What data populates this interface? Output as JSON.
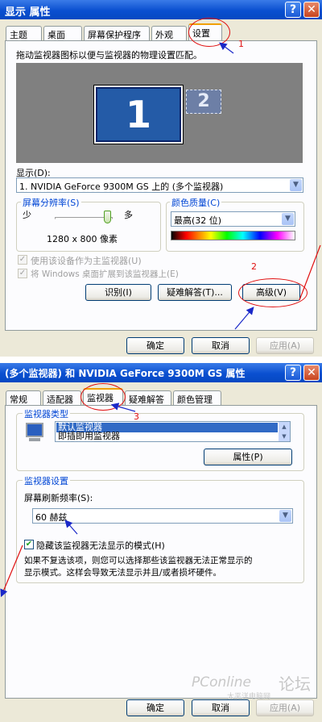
{
  "dialog1": {
    "title": "显示 属性",
    "tabs": [
      "主题",
      "桌面",
      "屏幕保护程序",
      "外观",
      "设置"
    ],
    "description": "拖动监视器图标以便与监视器的物理设置匹配。",
    "monitor1_number": "1",
    "monitor2_number": "2",
    "display_label": "显示(D):",
    "display_value": "1. NVIDIA GeForce 9300M GS 上的 (多个监视器)",
    "resolution_group": "屏幕分辨率(S)",
    "resolution_less": "少",
    "resolution_more": "多",
    "resolution_value": "1280 x 800 像素",
    "color_group": "颜色质量(C)",
    "color_value": "最高(32 位)",
    "checkbox_primary": "使用该设备作为主监视器(U)",
    "checkbox_extend": "将 Windows 桌面扩展到该监视器上(E)",
    "identify_button": "识别(I)",
    "troubleshoot_button": "疑难解答(T)...",
    "advanced_button": "高级(V)",
    "ok_button": "确定",
    "cancel_button": "取消",
    "apply_button": "应用(A)"
  },
  "dialog2": {
    "title": "(多个监视器) 和 NVIDIA GeForce 9300M GS 属性",
    "tabs": [
      "常规",
      "适配器",
      "监视器",
      "疑难解答",
      "颜色管理"
    ],
    "monitor_type_group": "监视器类型",
    "monitor_list": [
      "默认监视器",
      "即插即用监视器"
    ],
    "properties_button": "属性(P)",
    "monitor_settings_group": "监视器设置",
    "refresh_label": "屏幕刷新频率(S):",
    "refresh_value": "60 赫兹",
    "hide_modes_checkbox": "隐藏该监视器无法显示的模式(H)",
    "hide_modes_checked": true,
    "explanation": [
      "如果不复选该项，则您可以选择那些该监视器无法正常显示的",
      "显示模式。这样会导致无法显示并且/或者损坏硬件。"
    ],
    "ok_button": "确定",
    "cancel_button": "取消",
    "apply_button": "应用(A)"
  },
  "annotations": {
    "step1": "1",
    "step2": "2",
    "step3": "3",
    "color": "#e01010"
  },
  "watermark": {
    "brand": "PConline",
    "tag": "论坛",
    "sub": "太平洋电脑网"
  }
}
